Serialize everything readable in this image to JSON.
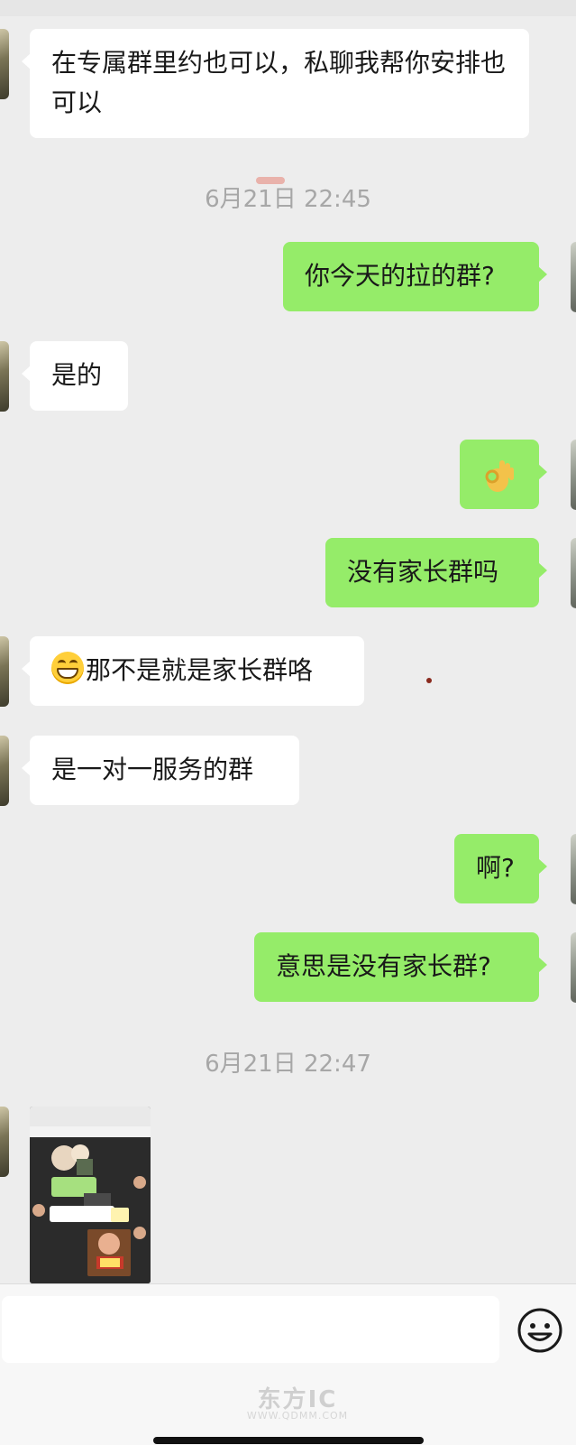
{
  "messages": [
    {
      "side": "left",
      "text": "在专属群里约也可以，私聊我帮你安排也可以"
    },
    {
      "time": "6月21日 22:45"
    },
    {
      "side": "right",
      "text": "你今天的拉的群?"
    },
    {
      "side": "left",
      "text": "是的"
    },
    {
      "side": "right",
      "emoji": "ok-hand-icon"
    },
    {
      "side": "right",
      "text": "没有家长群吗"
    },
    {
      "side": "left",
      "emoji": "grinning-face-icon",
      "text": "那不是就是家长群咯"
    },
    {
      "side": "left",
      "text": "是一对一服务的群"
    },
    {
      "side": "right",
      "text": "啊?"
    },
    {
      "side": "right",
      "text": "意思是没有家长群?"
    },
    {
      "time": "6月21日 22:47"
    },
    {
      "side": "left",
      "image": "chat-screenshot-thumbnail"
    }
  ],
  "colors": {
    "background": "#ededed",
    "sent_bubble": "#95ec69",
    "received_bubble": "#ffffff",
    "timestamp": "#a7a7a7"
  },
  "input_bar": {
    "emoji_button_icon": "smiley-icon"
  },
  "watermark": {
    "title": "东方IC",
    "sub": "WWW.QDMM.COM"
  }
}
